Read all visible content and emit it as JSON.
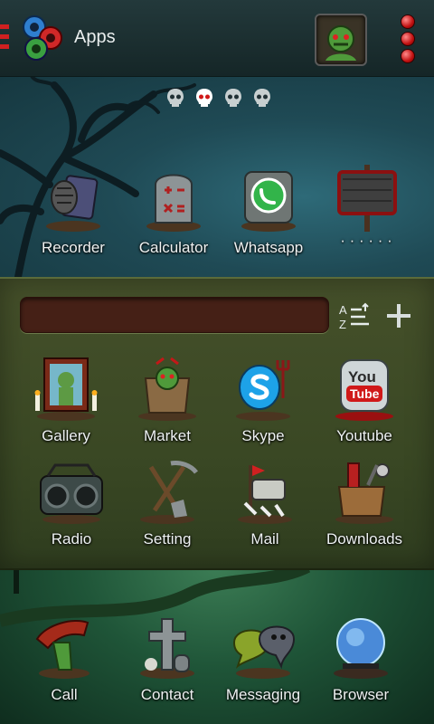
{
  "topbar": {
    "title": "Apps"
  },
  "home_row": [
    {
      "label": "Recorder"
    },
    {
      "label": "Calculator"
    },
    {
      "label": "Whatsapp"
    },
    {
      "label": "· · · · · ·"
    }
  ],
  "drawer": {
    "search": {
      "value": "",
      "placeholder": ""
    },
    "apps": [
      {
        "label": "Gallery"
      },
      {
        "label": "Market"
      },
      {
        "label": "Skype"
      },
      {
        "label": "Youtube"
      },
      {
        "label": "Radio"
      },
      {
        "label": "Setting"
      },
      {
        "label": "Mail"
      },
      {
        "label": "Downloads"
      }
    ],
    "youtube_icon_text": {
      "top": "You",
      "bottom": "Tube"
    },
    "sort_icon_text": {
      "top": "A",
      "bottom": "Z"
    }
  },
  "dock": [
    {
      "label": "Call"
    },
    {
      "label": "Contact"
    },
    {
      "label": "Messaging"
    },
    {
      "label": "Browser"
    }
  ],
  "page_indicator": {
    "pages": 4,
    "current": 2
  },
  "colors": {
    "accent_red": "#d02020",
    "drawer": "#3a4824",
    "search_field": "#452016"
  }
}
